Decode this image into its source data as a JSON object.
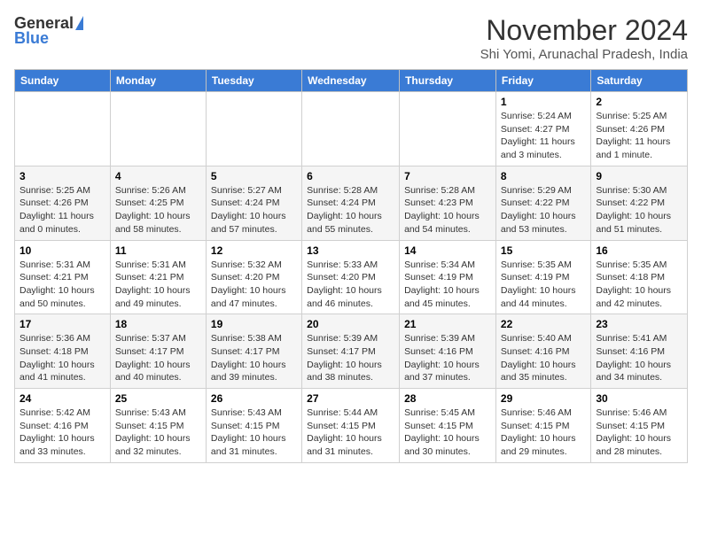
{
  "header": {
    "logo_general": "General",
    "logo_blue": "Blue",
    "month_title": "November 2024",
    "location": "Shi Yomi, Arunachal Pradesh, India"
  },
  "days_of_week": [
    "Sunday",
    "Monday",
    "Tuesday",
    "Wednesday",
    "Thursday",
    "Friday",
    "Saturday"
  ],
  "weeks": [
    [
      {
        "day": "",
        "info": ""
      },
      {
        "day": "",
        "info": ""
      },
      {
        "day": "",
        "info": ""
      },
      {
        "day": "",
        "info": ""
      },
      {
        "day": "",
        "info": ""
      },
      {
        "day": "1",
        "info": "Sunrise: 5:24 AM\nSunset: 4:27 PM\nDaylight: 11 hours and 3 minutes."
      },
      {
        "day": "2",
        "info": "Sunrise: 5:25 AM\nSunset: 4:26 PM\nDaylight: 11 hours and 1 minute."
      }
    ],
    [
      {
        "day": "3",
        "info": "Sunrise: 5:25 AM\nSunset: 4:26 PM\nDaylight: 11 hours and 0 minutes."
      },
      {
        "day": "4",
        "info": "Sunrise: 5:26 AM\nSunset: 4:25 PM\nDaylight: 10 hours and 58 minutes."
      },
      {
        "day": "5",
        "info": "Sunrise: 5:27 AM\nSunset: 4:24 PM\nDaylight: 10 hours and 57 minutes."
      },
      {
        "day": "6",
        "info": "Sunrise: 5:28 AM\nSunset: 4:24 PM\nDaylight: 10 hours and 55 minutes."
      },
      {
        "day": "7",
        "info": "Sunrise: 5:28 AM\nSunset: 4:23 PM\nDaylight: 10 hours and 54 minutes."
      },
      {
        "day": "8",
        "info": "Sunrise: 5:29 AM\nSunset: 4:22 PM\nDaylight: 10 hours and 53 minutes."
      },
      {
        "day": "9",
        "info": "Sunrise: 5:30 AM\nSunset: 4:22 PM\nDaylight: 10 hours and 51 minutes."
      }
    ],
    [
      {
        "day": "10",
        "info": "Sunrise: 5:31 AM\nSunset: 4:21 PM\nDaylight: 10 hours and 50 minutes."
      },
      {
        "day": "11",
        "info": "Sunrise: 5:31 AM\nSunset: 4:21 PM\nDaylight: 10 hours and 49 minutes."
      },
      {
        "day": "12",
        "info": "Sunrise: 5:32 AM\nSunset: 4:20 PM\nDaylight: 10 hours and 47 minutes."
      },
      {
        "day": "13",
        "info": "Sunrise: 5:33 AM\nSunset: 4:20 PM\nDaylight: 10 hours and 46 minutes."
      },
      {
        "day": "14",
        "info": "Sunrise: 5:34 AM\nSunset: 4:19 PM\nDaylight: 10 hours and 45 minutes."
      },
      {
        "day": "15",
        "info": "Sunrise: 5:35 AM\nSunset: 4:19 PM\nDaylight: 10 hours and 44 minutes."
      },
      {
        "day": "16",
        "info": "Sunrise: 5:35 AM\nSunset: 4:18 PM\nDaylight: 10 hours and 42 minutes."
      }
    ],
    [
      {
        "day": "17",
        "info": "Sunrise: 5:36 AM\nSunset: 4:18 PM\nDaylight: 10 hours and 41 minutes."
      },
      {
        "day": "18",
        "info": "Sunrise: 5:37 AM\nSunset: 4:17 PM\nDaylight: 10 hours and 40 minutes."
      },
      {
        "day": "19",
        "info": "Sunrise: 5:38 AM\nSunset: 4:17 PM\nDaylight: 10 hours and 39 minutes."
      },
      {
        "day": "20",
        "info": "Sunrise: 5:39 AM\nSunset: 4:17 PM\nDaylight: 10 hours and 38 minutes."
      },
      {
        "day": "21",
        "info": "Sunrise: 5:39 AM\nSunset: 4:16 PM\nDaylight: 10 hours and 37 minutes."
      },
      {
        "day": "22",
        "info": "Sunrise: 5:40 AM\nSunset: 4:16 PM\nDaylight: 10 hours and 35 minutes."
      },
      {
        "day": "23",
        "info": "Sunrise: 5:41 AM\nSunset: 4:16 PM\nDaylight: 10 hours and 34 minutes."
      }
    ],
    [
      {
        "day": "24",
        "info": "Sunrise: 5:42 AM\nSunset: 4:16 PM\nDaylight: 10 hours and 33 minutes."
      },
      {
        "day": "25",
        "info": "Sunrise: 5:43 AM\nSunset: 4:15 PM\nDaylight: 10 hours and 32 minutes."
      },
      {
        "day": "26",
        "info": "Sunrise: 5:43 AM\nSunset: 4:15 PM\nDaylight: 10 hours and 31 minutes."
      },
      {
        "day": "27",
        "info": "Sunrise: 5:44 AM\nSunset: 4:15 PM\nDaylight: 10 hours and 31 minutes."
      },
      {
        "day": "28",
        "info": "Sunrise: 5:45 AM\nSunset: 4:15 PM\nDaylight: 10 hours and 30 minutes."
      },
      {
        "day": "29",
        "info": "Sunrise: 5:46 AM\nSunset: 4:15 PM\nDaylight: 10 hours and 29 minutes."
      },
      {
        "day": "30",
        "info": "Sunrise: 5:46 AM\nSunset: 4:15 PM\nDaylight: 10 hours and 28 minutes."
      }
    ]
  ]
}
